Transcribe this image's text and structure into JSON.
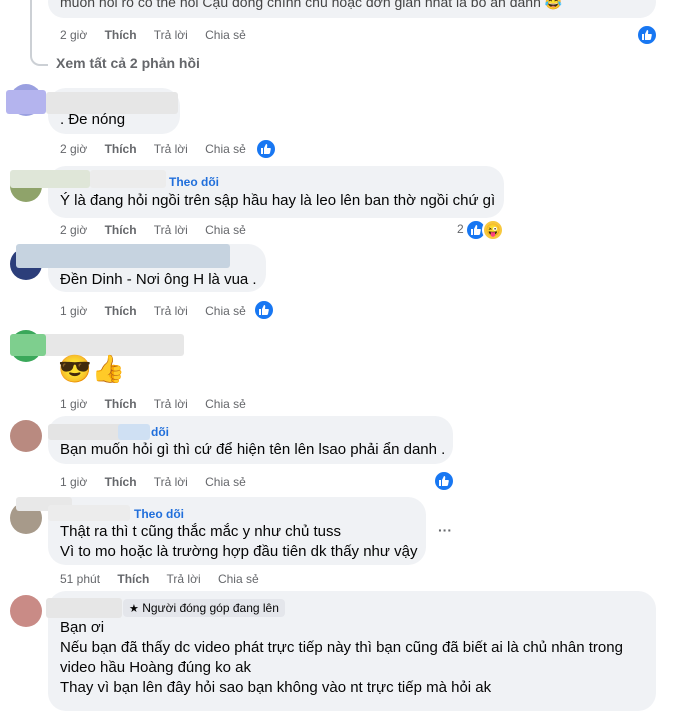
{
  "comments": [
    {
      "text_line": "muốn hỏi rõ có thể nói Cậu đồng chính chủ hoặc đơn giản nhất là bỏ ẩn danh 😂",
      "time": "2 giờ",
      "like": "Thích",
      "reply": "Trả lời",
      "share": "Chia sẻ"
    },
    {
      "view_replies": "Xem tất cả 2 phản hồi"
    },
    {
      "text_line": ". Đe nóng",
      "time": "2 giờ",
      "like": "Thích",
      "reply": "Trả lời",
      "share": "Chia sẻ"
    },
    {
      "follow": "Theo dõi",
      "text_line": "Ý là đang hỏi ngồi trên sập hầu hay là leo lên ban thờ ngồi chứ gì",
      "time": "2 giờ",
      "like": "Thích",
      "reply": "Trả lời",
      "share": "Chia sẻ",
      "reaction_count": "2"
    },
    {
      "text_line": "Đền Dinh - Nơi ông H là vua .",
      "time": "1 giờ",
      "like": "Thích",
      "reply": "Trả lời",
      "share": "Chia sẻ"
    },
    {
      "emoji": "😎👍",
      "time": "1 giờ",
      "like": "Thích",
      "reply": "Trả lời",
      "share": "Chia sẻ"
    },
    {
      "follow": "dõi",
      "text_line": "Bạn muốn hỏi gì thì cứ để hiện tên lên lsao phải ẩn danh .",
      "time": "1 giờ",
      "like": "Thích",
      "reply": "Trả lời",
      "share": "Chia sẻ"
    },
    {
      "follow": "Theo dõi",
      "text_line_1": "Thật ra thì t cũng thắc mắc y như chủ tuss",
      "text_line_2": "Vì to mo hoặc là trường hợp đầu tiên dk thấy như vậy",
      "time": "51 phút",
      "like": "Thích",
      "reply": "Trả lời",
      "share": "Chia sẻ",
      "more": "···"
    },
    {
      "badge": "Người đóng góp đang lên",
      "text_line_1": "Bạn ơi",
      "text_line_2": "Nếu bạn đã thấy dc video phát trực tiếp này thì bạn cũng đã biết ai là chủ nhân trong",
      "text_line_3": "video hầu Hoàng đúng ko ak",
      "text_line_4": "Thay vì bạn lên đây hỏi sao bạn không vào nt trực tiếp mà hỏi ak"
    }
  ]
}
